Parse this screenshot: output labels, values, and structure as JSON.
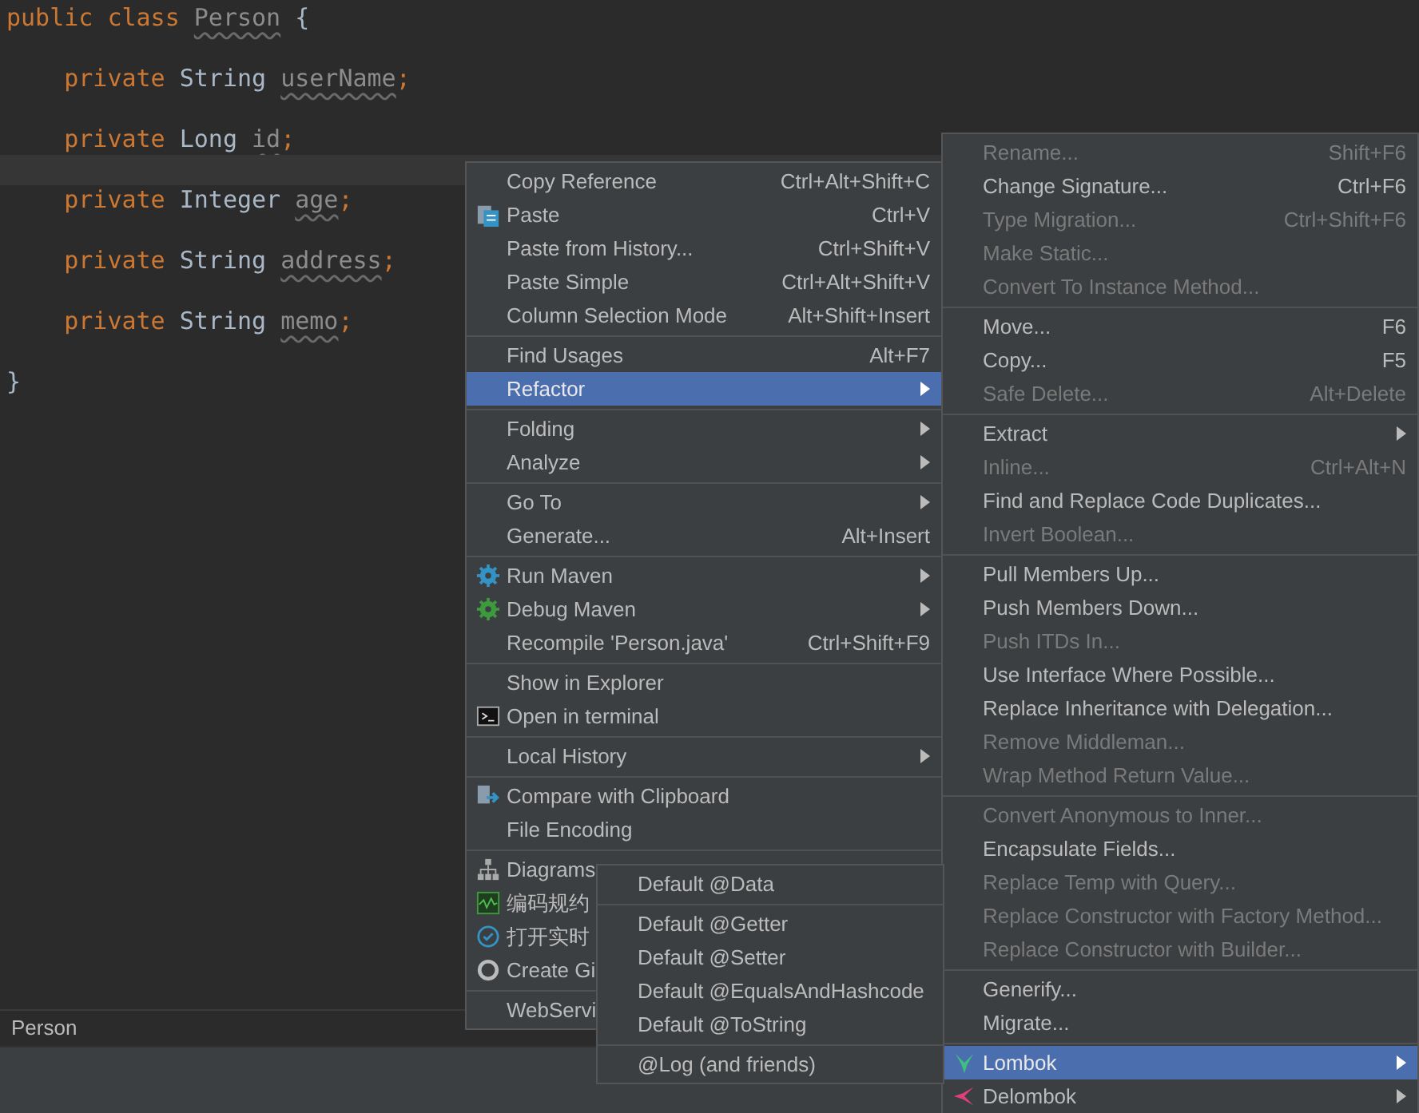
{
  "editor": {
    "lines": [
      {
        "tokens": [
          {
            "kind": "keyword",
            "text": "public class "
          },
          {
            "kind": "unused",
            "text": "Person"
          },
          {
            "kind": "plain",
            "text": " {"
          }
        ]
      },
      {
        "current": false
      },
      {
        "tokens": [
          {
            "kind": "keyword",
            "text": "    private "
          },
          {
            "kind": "plain",
            "text": "String "
          },
          {
            "kind": "unused",
            "text": "userName"
          },
          {
            "kind": "keyword",
            "text": ";"
          }
        ]
      },
      {
        "current": false
      },
      {
        "tokens": [
          {
            "kind": "keyword",
            "text": "    private "
          },
          {
            "kind": "plain",
            "text": "Long "
          },
          {
            "kind": "unused",
            "text": "id"
          },
          {
            "kind": "keyword",
            "text": ";"
          }
        ]
      },
      {
        "current": true
      },
      {
        "tokens": [
          {
            "kind": "keyword",
            "text": "    private "
          },
          {
            "kind": "plain",
            "text": "Integer "
          },
          {
            "kind": "unused",
            "text": "age"
          },
          {
            "kind": "keyword",
            "text": ";"
          }
        ]
      },
      {
        "current": false
      },
      {
        "tokens": [
          {
            "kind": "keyword",
            "text": "    private "
          },
          {
            "kind": "plain",
            "text": "String "
          },
          {
            "kind": "unused",
            "text": "address"
          },
          {
            "kind": "keyword",
            "text": ";"
          }
        ]
      },
      {
        "current": false
      },
      {
        "tokens": [
          {
            "kind": "keyword",
            "text": "    private "
          },
          {
            "kind": "plain",
            "text": "String "
          },
          {
            "kind": "unused",
            "text": "memo"
          },
          {
            "kind": "keyword",
            "text": ";"
          }
        ]
      },
      {
        "current": false
      },
      {
        "tokens": [
          {
            "kind": "plain",
            "text": "}"
          }
        ]
      }
    ]
  },
  "breadcrumb": "Person",
  "context_menu": {
    "groups": [
      [
        {
          "label": "Copy Reference",
          "shortcut": "Ctrl+Alt+Shift+C",
          "selected": false
        },
        {
          "label": "Paste",
          "shortcut": "Ctrl+V",
          "selected": false
        },
        {
          "label": "Paste from History...",
          "shortcut": "Ctrl+Shift+V",
          "selected": false
        },
        {
          "label": "Paste Simple",
          "shortcut": "Ctrl+Alt+Shift+V",
          "selected": false
        },
        {
          "label": "Column Selection Mode",
          "shortcut": "Alt+Shift+Insert",
          "selected": false
        }
      ],
      [
        {
          "label": "Find Usages",
          "shortcut": "Alt+F7",
          "selected": false
        },
        {
          "label": "Refactor",
          "submenu": true,
          "selected": true
        }
      ],
      [
        {
          "label": "Folding",
          "submenu": true,
          "selected": false
        },
        {
          "label": "Analyze",
          "submenu": true,
          "selected": false
        }
      ],
      [
        {
          "label": "Go To",
          "submenu": true,
          "selected": false
        },
        {
          "label": "Generate...",
          "shortcut": "Alt+Insert",
          "selected": false
        }
      ],
      [
        {
          "label": "Run Maven",
          "submenu": true,
          "selected": false
        },
        {
          "label": "Debug Maven",
          "submenu": true,
          "selected": false
        },
        {
          "label": "Recompile 'Person.java'",
          "shortcut": "Ctrl+Shift+F9",
          "selected": false
        }
      ],
      [
        {
          "label": "Show in Explorer",
          "selected": false
        },
        {
          "label": "Open in terminal",
          "selected": false
        }
      ],
      [
        {
          "label": "Local History",
          "submenu": true,
          "selected": false
        }
      ],
      [
        {
          "label": "Compare with Clipboard",
          "selected": false
        },
        {
          "label": "File Encoding",
          "selected": false
        }
      ],
      [
        {
          "label": "Diagrams",
          "selected": false
        },
        {
          "label": "编码规约",
          "selected": false
        },
        {
          "label": "打开实时",
          "selected": false
        },
        {
          "label": "Create Gi",
          "selected": false
        }
      ],
      [
        {
          "label": "WebServi",
          "selected": false
        }
      ]
    ]
  },
  "refactor_menu": {
    "groups": [
      [
        {
          "label": "Rename...",
          "shortcut": "Shift+F6",
          "disabled": true,
          "selected": false
        },
        {
          "label": "Change Signature...",
          "shortcut": "Ctrl+F6",
          "disabled": false,
          "selected": false
        },
        {
          "label": "Type Migration...",
          "shortcut": "Ctrl+Shift+F6",
          "disabled": true,
          "selected": false
        },
        {
          "label": "Make Static...",
          "disabled": true,
          "selected": false
        },
        {
          "label": "Convert To Instance Method...",
          "disabled": true,
          "selected": false
        }
      ],
      [
        {
          "label": "Move...",
          "shortcut": "F6",
          "disabled": false,
          "selected": false
        },
        {
          "label": "Copy...",
          "shortcut": "F5",
          "disabled": false,
          "selected": false
        },
        {
          "label": "Safe Delete...",
          "shortcut": "Alt+Delete",
          "disabled": true,
          "selected": false
        }
      ],
      [
        {
          "label": "Extract",
          "submenu": true,
          "disabled": false,
          "selected": false
        },
        {
          "label": "Inline...",
          "shortcut": "Ctrl+Alt+N",
          "disabled": true,
          "selected": false
        },
        {
          "label": "Find and Replace Code Duplicates...",
          "disabled": false,
          "selected": false
        },
        {
          "label": "Invert Boolean...",
          "disabled": true,
          "selected": false
        }
      ],
      [
        {
          "label": "Pull Members Up...",
          "disabled": false,
          "selected": false
        },
        {
          "label": "Push Members Down...",
          "disabled": false,
          "selected": false
        },
        {
          "label": "Push ITDs In...",
          "disabled": true,
          "selected": false
        },
        {
          "label": "Use Interface Where Possible...",
          "disabled": false,
          "selected": false
        },
        {
          "label": "Replace Inheritance with Delegation...",
          "disabled": false,
          "selected": false
        },
        {
          "label": "Remove Middleman...",
          "disabled": true,
          "selected": false
        },
        {
          "label": "Wrap Method Return Value...",
          "disabled": true,
          "selected": false
        }
      ],
      [
        {
          "label": "Convert Anonymous to Inner...",
          "disabled": true,
          "selected": false
        },
        {
          "label": "Encapsulate Fields...",
          "disabled": false,
          "selected": false
        },
        {
          "label": "Replace Temp with Query...",
          "disabled": true,
          "selected": false
        },
        {
          "label": "Replace Constructor with Factory Method...",
          "disabled": true,
          "selected": false
        },
        {
          "label": "Replace Constructor with Builder...",
          "disabled": true,
          "selected": false
        }
      ],
      [
        {
          "label": "Generify...",
          "disabled": false,
          "selected": false
        },
        {
          "label": "Migrate...",
          "disabled": false,
          "selected": false
        }
      ],
      [
        {
          "label": "Lombok",
          "submenu": true,
          "disabled": false,
          "selected": true
        },
        {
          "label": "Delombok",
          "submenu": true,
          "disabled": false,
          "selected": false
        }
      ]
    ]
  },
  "lombok_menu": {
    "groups": [
      [
        {
          "label": "Default @Data",
          "selected": false
        }
      ],
      [
        {
          "label": "Default @Getter",
          "selected": false
        },
        {
          "label": "Default @Setter",
          "selected": false
        },
        {
          "label": "Default @EqualsAndHashcode",
          "selected": false
        },
        {
          "label": "Default @ToString",
          "selected": false
        }
      ],
      [
        {
          "label": "@Log (and friends)",
          "selected": false
        }
      ]
    ]
  }
}
